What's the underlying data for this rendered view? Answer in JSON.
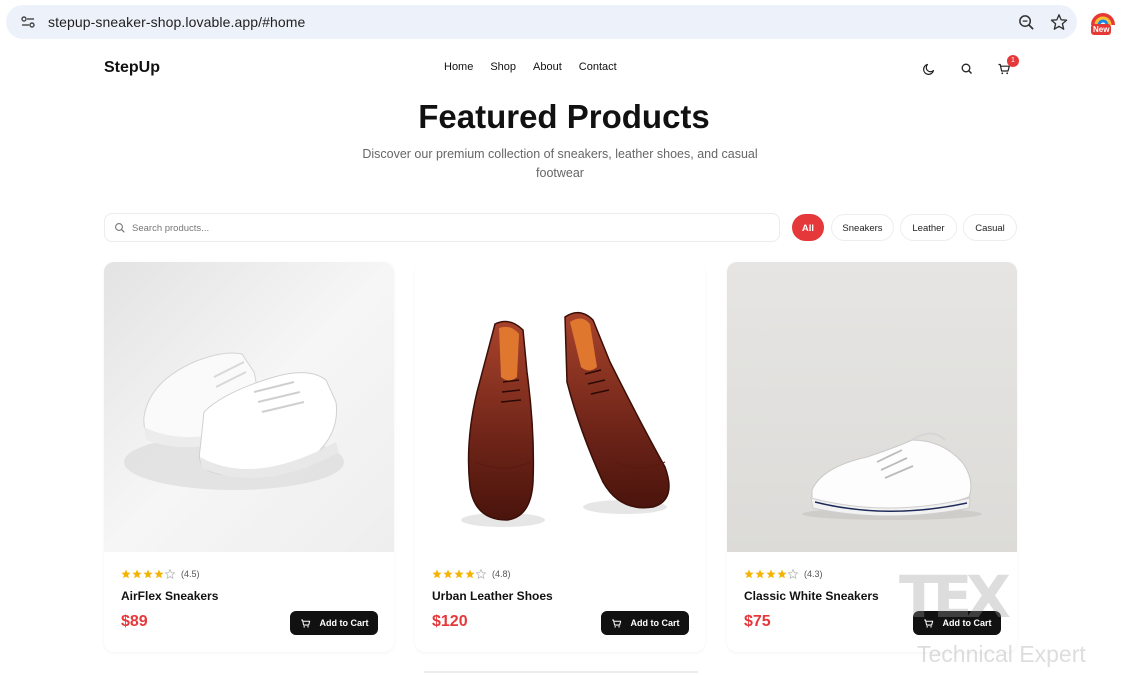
{
  "browser": {
    "url": "stepup-sneaker-shop.lovable.app/#home",
    "extension_badge": "New"
  },
  "header": {
    "brand": "StepUp",
    "nav": [
      "Home",
      "Shop",
      "About",
      "Contact"
    ],
    "cart_count": "1"
  },
  "hero": {
    "title": "Featured Products",
    "subtitle": "Discover our premium collection of sneakers, leather shoes, and casual footwear"
  },
  "search": {
    "placeholder": "Search products..."
  },
  "filters": {
    "all": "All",
    "sneakers": "Sneakers",
    "leather": "Leather",
    "casual": "Casual",
    "active": "All"
  },
  "products": [
    {
      "name": "AirFlex Sneakers",
      "price": "$89",
      "rating": 4.5,
      "rating_label": "(4.5)",
      "button": "Add to Cart"
    },
    {
      "name": "Urban Leather Shoes",
      "price": "$120",
      "rating": 4.8,
      "rating_label": "(4.8)",
      "button": "Add to Cart"
    },
    {
      "name": "Classic White Sneakers",
      "price": "$75",
      "rating": 4.3,
      "rating_label": "(4.3)",
      "button": "Add to Cart"
    }
  ],
  "watermark": {
    "logo": "TEX",
    "text": "Technical Expert"
  },
  "colors": {
    "accent": "#e5383b",
    "star": "#f5b301",
    "button": "#111111"
  }
}
